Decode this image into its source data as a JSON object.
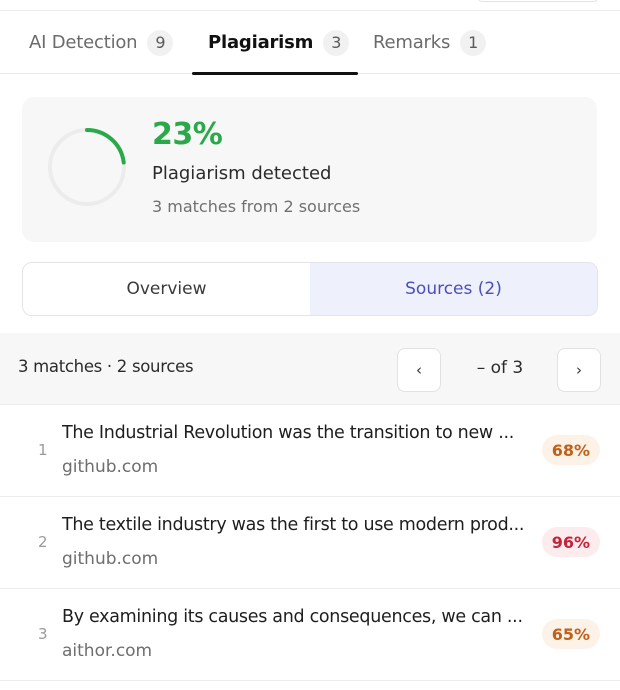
{
  "tabs": [
    {
      "label": "AI Detection",
      "count": "9"
    },
    {
      "label": "Plagiarism",
      "count": "3"
    },
    {
      "label": "Remarks",
      "count": "1"
    }
  ],
  "summary": {
    "percent": "23%",
    "percent_value": 0.23,
    "label": "Plagiarism detected",
    "sub": "3 matches from 2 sources",
    "ring_color": "#2aa84a",
    "ring_track_color": "#ececec"
  },
  "view_toggle": {
    "overview": "Overview",
    "sources": "Sources (2)",
    "active": "sources"
  },
  "results": {
    "count_text": "3 matches · 2 sources",
    "prev_icon": "‹",
    "next_icon": "›",
    "pager_text": "– of 3"
  },
  "matches": [
    {
      "index": "1",
      "title": "The Industrial Revolution was the transition to new ...",
      "domain": "github.com",
      "percent": "68%",
      "text_color": "#c0611a",
      "bg_color": "#fdf2e8"
    },
    {
      "index": "2",
      "title": "The textile industry was the first to use modern prod...",
      "domain": "github.com",
      "percent": "96%",
      "text_color": "#c4243a",
      "bg_color": "#fdecee"
    },
    {
      "index": "3",
      "title": "By examining its causes and consequences, we can ...",
      "domain": "aithor.com",
      "percent": "65%",
      "text_color": "#c0611a",
      "bg_color": "#fdf2e8"
    }
  ]
}
